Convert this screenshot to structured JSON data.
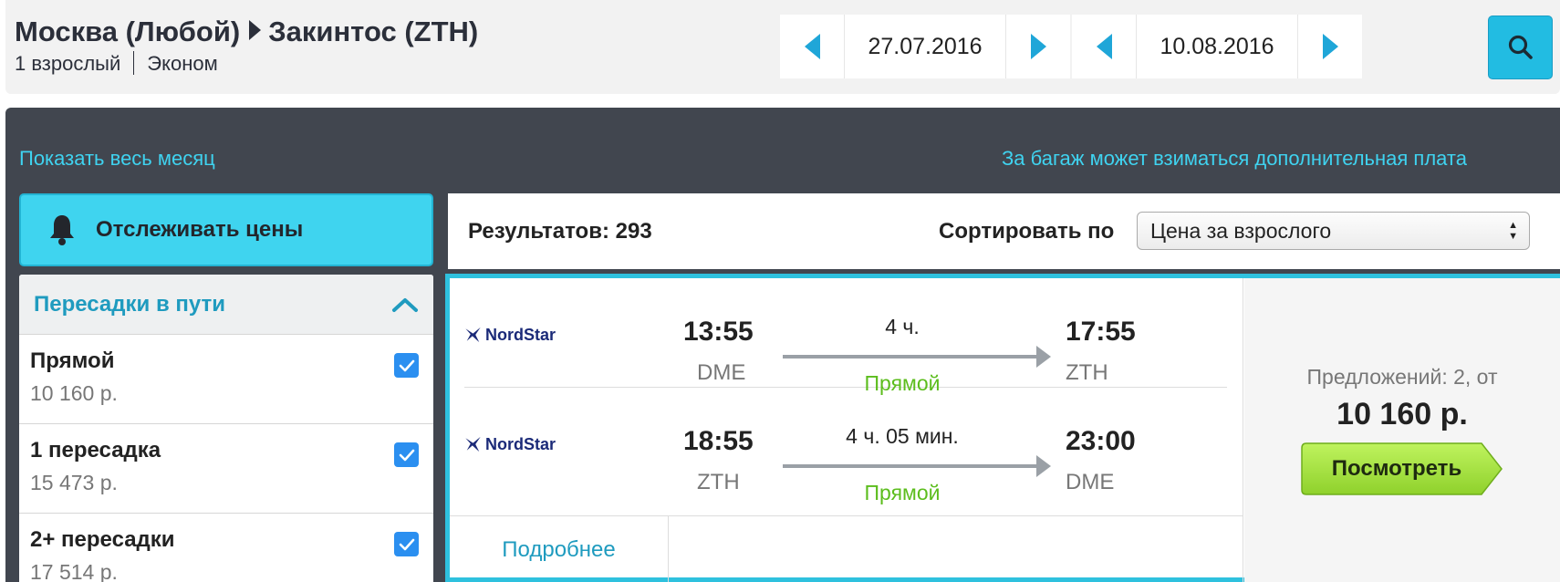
{
  "search": {
    "route_from": "Москва (Любой)",
    "route_to": "Закинтос (ZTH)",
    "passengers": "1 взрослый",
    "cabin": "Эконом",
    "depart_date": "27.07.2016",
    "return_date": "10.08.2016"
  },
  "links": {
    "show_month": "Показать весь месяц",
    "baggage_note": "За багаж может взиматься дополнительная плата"
  },
  "track": {
    "label": "Отслеживать цены"
  },
  "filters": {
    "title": "Пересадки в пути",
    "items": [
      {
        "name": "Прямой",
        "price": "10 160 р.",
        "checked": true
      },
      {
        "name": "1 пересадка",
        "price": "15 473 р.",
        "checked": true
      },
      {
        "name": "2+ пересадки",
        "price": "17 514 р.",
        "checked": true
      }
    ]
  },
  "results": {
    "count_label": "Результатов: 293",
    "sort_label": "Сортировать по",
    "sort_value": "Цена за взрослого"
  },
  "card": {
    "legs": [
      {
        "airline": "NordStar",
        "dep_time": "13:55",
        "dep_airport": "DME",
        "duration": "4 ч.",
        "stops": "Прямой",
        "arr_time": "17:55",
        "arr_airport": "ZTH"
      },
      {
        "airline": "NordStar",
        "dep_time": "18:55",
        "dep_airport": "ZTH",
        "duration": "4 ч. 05 мин.",
        "stops": "Прямой",
        "arr_time": "23:00",
        "arr_airport": "DME"
      }
    ],
    "details_link": "Подробнее",
    "offers_label": "Предложений: 2, от",
    "price": "10 160 р.",
    "view_button": "Посмотреть"
  },
  "colors": {
    "accent": "#22bce2",
    "link": "#3fd3f0",
    "dark_panel": "#41464f",
    "direct_green": "#5cbd1d",
    "checkbox_blue": "#2b8ff0"
  },
  "icons": [
    "chevron-left-icon",
    "chevron-right-icon",
    "search-icon",
    "bell-icon",
    "chevron-up-icon",
    "checkmark-icon",
    "airline-logo-icon",
    "arrow-right-icon"
  ]
}
